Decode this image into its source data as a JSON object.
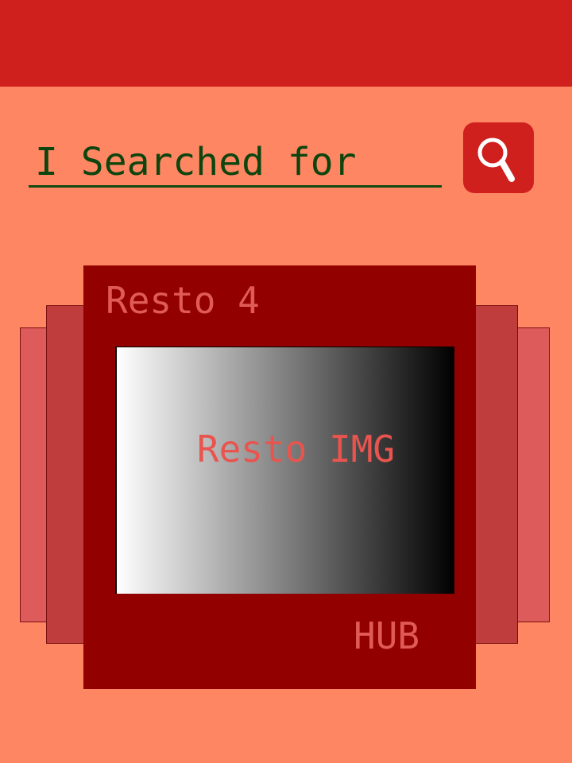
{
  "search": {
    "text": "I Searched for",
    "button_icon": "search-icon"
  },
  "carousel": {
    "card": {
      "title": "Resto 4",
      "image_label": "Resto IMG",
      "footer": "HUB"
    }
  },
  "colors": {
    "background": "#FF8662",
    "top_bar": "#D0201E",
    "card": "#930000",
    "side_inner": "#C03D3D",
    "side_outer": "#DE5B5B",
    "search_text": "#0E440E",
    "card_text": "#E05B55"
  }
}
